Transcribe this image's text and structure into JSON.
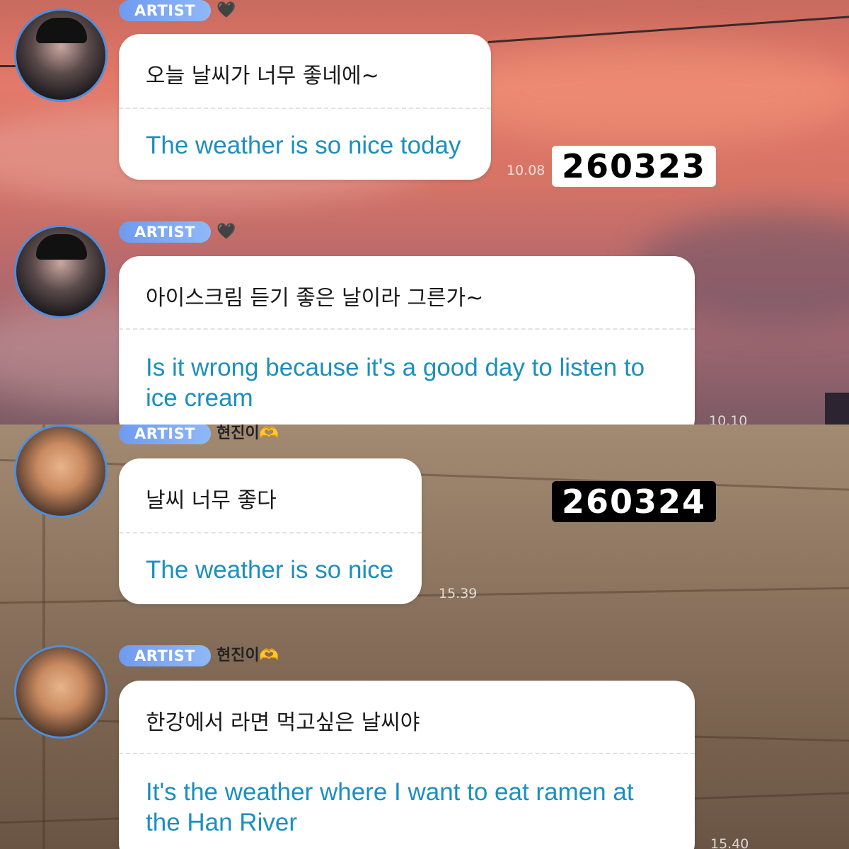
{
  "colors": {
    "badge": "#6f9bf0",
    "translation_text": "#1c8fbe",
    "avatar_ring": "#4b8fe0",
    "date_light_bg": "#ffffff",
    "date_dark_bg": "#000000"
  },
  "top": {
    "date_label": "260323",
    "messages": [
      {
        "badge": "ARTIST",
        "emoji": "🖤",
        "korean": "오늘 날씨가 너무 좋네에~",
        "english": "The weather is so nice today",
        "time": "10.08"
      },
      {
        "badge": "ARTIST",
        "emoji": "🖤",
        "korean": "아이스크림 듣기 좋은 날이라 그른가~",
        "english": "Is it wrong because it's a good day to listen to ice cream",
        "time": "10.10"
      }
    ]
  },
  "bottom": {
    "date_label": "260324",
    "messages": [
      {
        "badge": "ARTIST",
        "name": "현진이",
        "emoji": "🫶",
        "korean": "날씨 너무 좋다",
        "english": "The weather is so nice",
        "time": "15.39"
      },
      {
        "badge": "ARTIST",
        "name": "현진이",
        "emoji": "🫶",
        "korean": "한강에서 라면 먹고싶은 날씨야",
        "english": "It's the weather where I want to eat ramen at the Han River",
        "time": "15.40"
      }
    ]
  }
}
